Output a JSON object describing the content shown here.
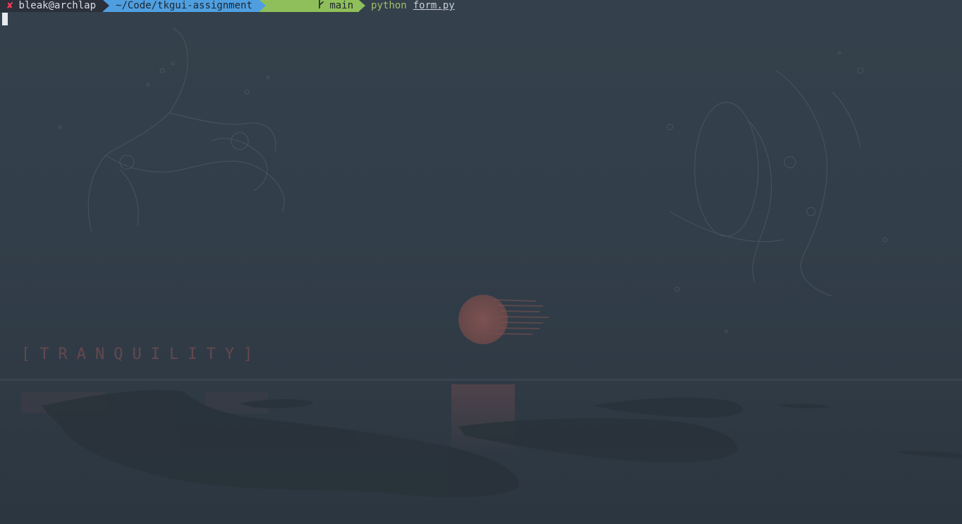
{
  "prompt": {
    "status_icon": "✘",
    "user_host": "bleak@archlap",
    "path": "~/Code/tkgui-assignment",
    "git_branch_icon": "branch-icon",
    "git_branch": "main",
    "command": "python",
    "command_arg": "form.py"
  },
  "wallpaper": {
    "caption": "[TRANQUILITY]"
  },
  "colors": {
    "background": "#323d48",
    "status_error": "#ff3b5c",
    "path_segment": "#4f9fe0",
    "git_segment": "#8fbf5a",
    "command": "#a3be6c"
  }
}
